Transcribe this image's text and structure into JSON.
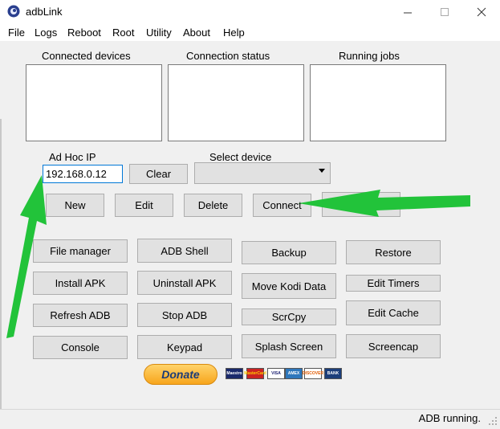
{
  "window": {
    "title": "adbLink"
  },
  "menu": [
    "File",
    "Logs",
    "Reboot",
    "Root",
    "Utility",
    "About",
    "Help"
  ],
  "panels": {
    "connected_devices": "Connected devices",
    "connection_status": "Connection status",
    "running_jobs": "Running jobs"
  },
  "adhoc": {
    "label": "Ad Hoc IP",
    "value": "192.168.0.12",
    "clear": "Clear"
  },
  "select_device": {
    "label": "Select device",
    "value": ""
  },
  "device_buttons": {
    "new": "New",
    "edit": "Edit",
    "delete": "Delete",
    "connect": "Connect"
  },
  "actions": {
    "file_manager": "File manager",
    "adb_shell": "ADB Shell",
    "backup": "Backup",
    "restore": "Restore",
    "install_apk": "Install APK",
    "uninstall_apk": "Uninstall APK",
    "move_kodi_data": "Move Kodi Data",
    "edit_timers": "Edit Timers",
    "refresh_adb": "Refresh ADB",
    "stop_adb": "Stop ADB",
    "scrcpy": "ScrCpy",
    "edit_cache": "Edit Cache",
    "console": "Console",
    "keypad": "Keypad",
    "splash_screen": "Splash Screen",
    "screencap": "Screencap"
  },
  "donate": {
    "label": "Donate",
    "cards": [
      "Maestro",
      "MasterCard",
      "VISA",
      "AMEX",
      "DISCOVER",
      "BANK"
    ]
  },
  "status": "ADB running.",
  "colors": {
    "arrow": "#22c33a",
    "focus": "#0078d7"
  }
}
